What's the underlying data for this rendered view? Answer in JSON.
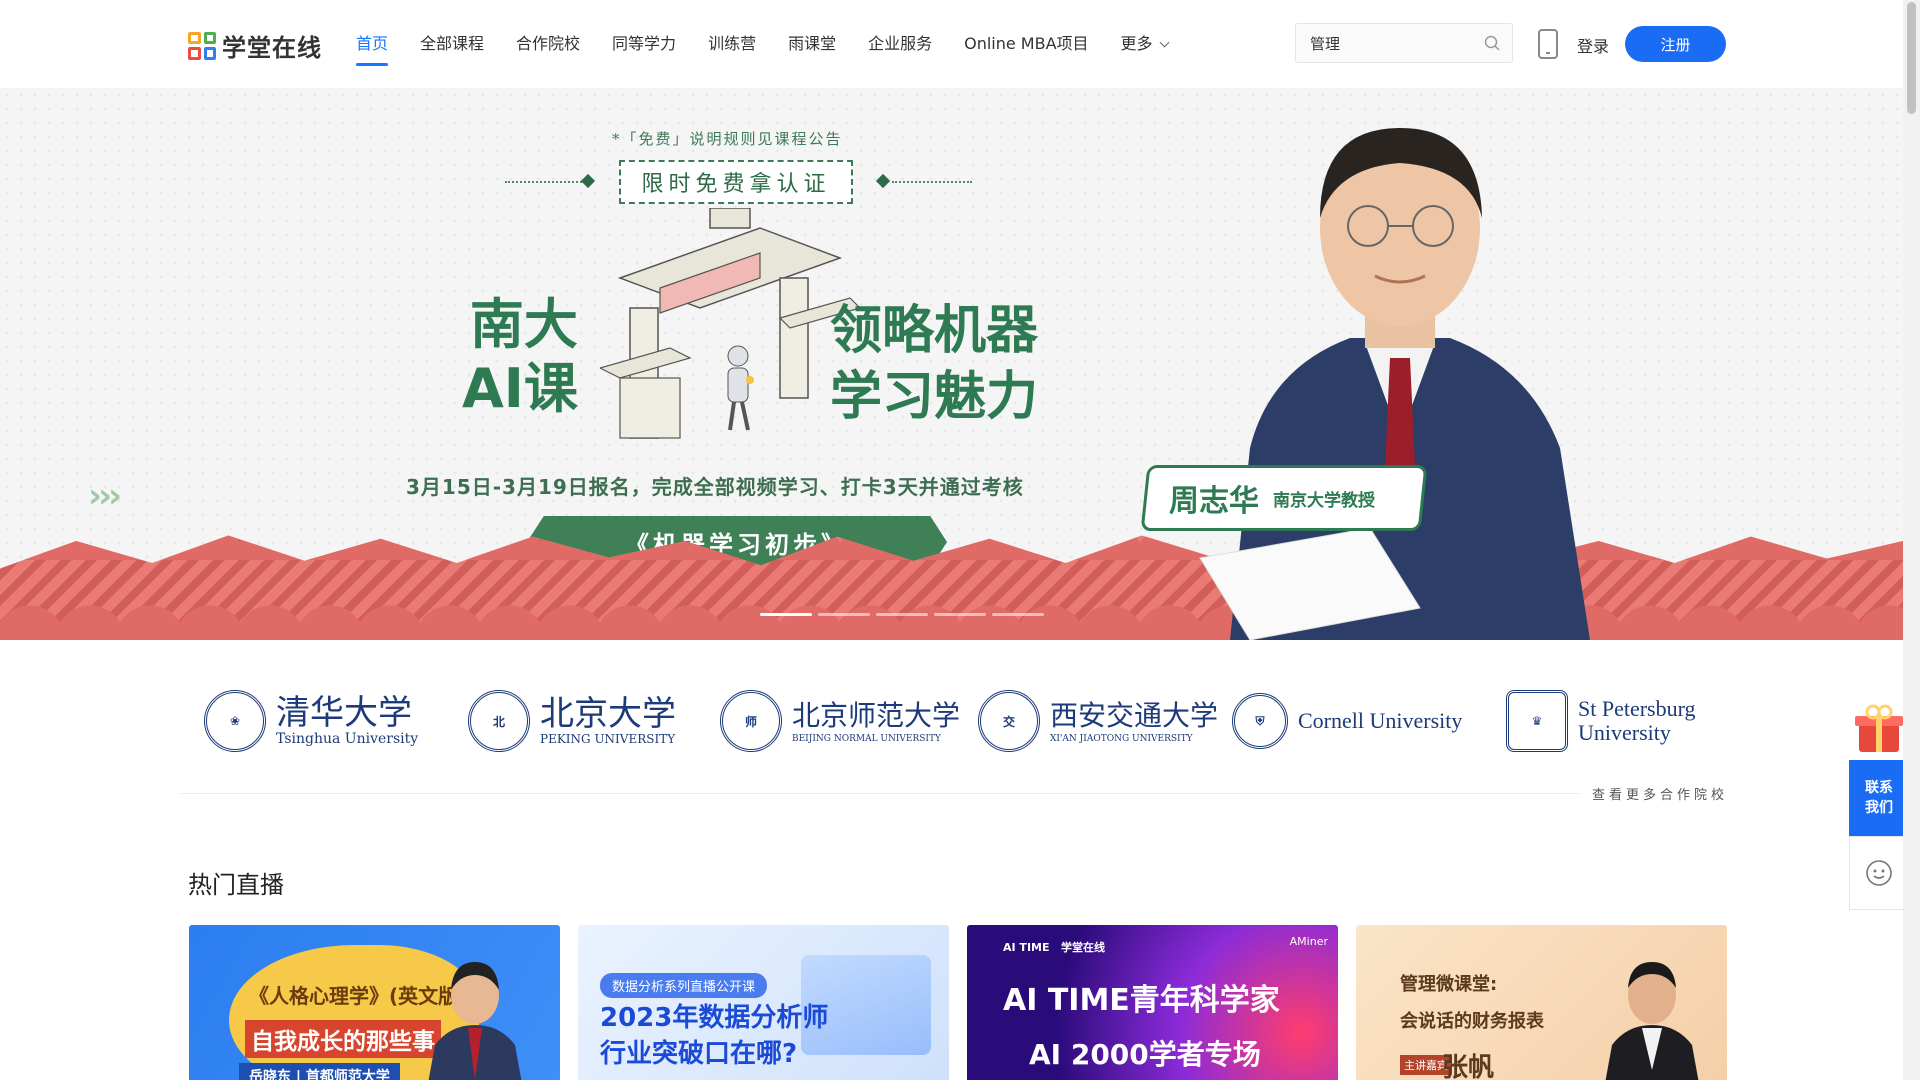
{
  "header": {
    "logo_text": "学堂在线",
    "nav": [
      "首页",
      "全部课程",
      "合作院校",
      "同等学力",
      "训练营",
      "雨课堂",
      "企业服务",
      "Online MBA项目",
      "更多"
    ],
    "search_value": "管理",
    "login": "登录",
    "register": "注册"
  },
  "banner": {
    "notice": "*「免费」说明规则见课程公告",
    "cert": "限时免费拿认证",
    "left_title_1": "南大",
    "left_title_2": "AI课",
    "right_title_1": "领略机器",
    "right_title_2": "学习魅力",
    "date_line": "3月15日-3月19日报名，完成全部视频学习、打卡3天并通过考核",
    "course": "《机器学习初步》",
    "person_name": "周志华",
    "person_title": "南京大学教授",
    "arrows": "›››",
    "active_slide": 0
  },
  "universities": {
    "items": [
      {
        "cn": "清华大学",
        "en": "Tsinghua University"
      },
      {
        "cn": "北京大学",
        "en": "PEKING UNIVERSITY"
      },
      {
        "cn": "北京师范大学",
        "en": "BEIJING NORMAL UNIVERSITY"
      },
      {
        "cn": "西安交通大学",
        "en": "XI'AN JIAOTONG UNIVERSITY"
      },
      {
        "en": "Cornell University"
      },
      {
        "en1": "St Petersburg",
        "en2": "University"
      }
    ],
    "more": "查看更多合作院校"
  },
  "section": {
    "title": "热门直播",
    "cards": [
      {
        "title": "《人格心理学》(英文版)",
        "subtitle": "自我成长的那些事",
        "speaker": "岳晓东",
        "org": "首都师范大学"
      },
      {
        "tag": "数据分析系列直播公开课",
        "line1": "2023年数据分析师",
        "line2": "行业突破口在哪?"
      },
      {
        "logo1": "AI TIME",
        "logo2": "学堂在线",
        "logo3": "AMiner",
        "line1": "AI TIME青年科学家",
        "line2": "AI 2000学者专场"
      },
      {
        "line1": "管理微课堂:",
        "line2": "会说话的财务报表",
        "tag": "主讲嘉宾",
        "speaker": "张帆"
      }
    ]
  },
  "side": {
    "contact_1": "联系",
    "contact_2": "我们"
  },
  "colors": {
    "primary": "#1a6cf5",
    "banner_green": "#2e7a52",
    "fence_red": "#e06b66"
  }
}
